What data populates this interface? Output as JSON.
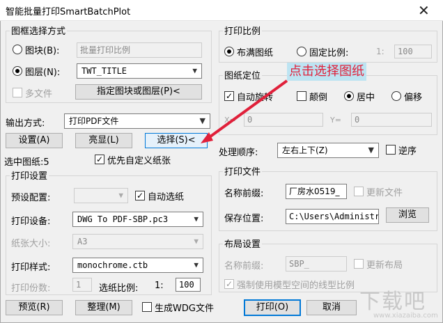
{
  "window": {
    "title": "智能批量打印SmartBatchPlot",
    "close": "✕"
  },
  "frame": {
    "group": "图框选择方式",
    "block_label": "图块(B):",
    "block_input": "批量打印比例",
    "layer_label": "图层(N):",
    "layer_value": "TWT_TITLE",
    "multifile_label": "多文件",
    "pick_button": "指定图块或图层(P)<"
  },
  "output": {
    "label": "输出方式:",
    "value": "打印PDF文件",
    "settings_button": "设置(A)",
    "highlight_button": "亮显(L)",
    "select_button": "选择(S)<",
    "selected_count": "选中图纸:5",
    "prefer_custom": "优先自定义纸张"
  },
  "print_settings": {
    "group": "打印设置",
    "preset_label": "预设配置:",
    "auto_paper": "自动选纸",
    "device_label": "打印设备:",
    "device_value": "DWG To PDF-SBP.pc3",
    "paper_label": "纸张大小:",
    "paper_value": "A3",
    "style_label": "打印样式:",
    "style_value": "monochrome.ctb",
    "copies_label": "打印份数:",
    "copies_value": "1",
    "scale_label": "选纸比例:",
    "scale_prefix": "1:",
    "scale_value": "100"
  },
  "ratio": {
    "group": "打印比例",
    "fill": "布满图纸",
    "fixed": "固定比例:",
    "fixed_prefix": "1:",
    "fixed_value": "100"
  },
  "position": {
    "group": "图纸定位",
    "auto_rotate": "自动旋转",
    "upside": "颠倒",
    "center": "居中",
    "offset": "偏移",
    "x_label": "X=",
    "x_value": "0",
    "y_label": "Y=",
    "y_value": "0"
  },
  "order": {
    "label": "处理顺序:",
    "value": "左右上下(Z)",
    "reverse": "逆序"
  },
  "file": {
    "group": "打印文件",
    "prefix_label": "名称前缀:",
    "prefix_value": "厂房水0519_",
    "update_file": "更新文件",
    "save_label": "保存位置:",
    "save_value": "C:\\Users\\Administrator",
    "browse": "浏览"
  },
  "layout": {
    "group": "布局设置",
    "prefix_label": "名称前缀:",
    "prefix_value": "SBP_",
    "update_layout": "更新布局",
    "force_linetype": "强制使用模型空间的线型比例"
  },
  "bottom": {
    "preview": "预览(R)",
    "arrange": "整理(M)",
    "gen_wdg": "生成WDG文件",
    "print": "打印(O)",
    "cancel": "取消"
  },
  "annotation": {
    "text": "点击选择图纸",
    "color": "#e0203a"
  },
  "watermark": {
    "text": "下载吧",
    "sub": "www.xiazaiba.com"
  }
}
